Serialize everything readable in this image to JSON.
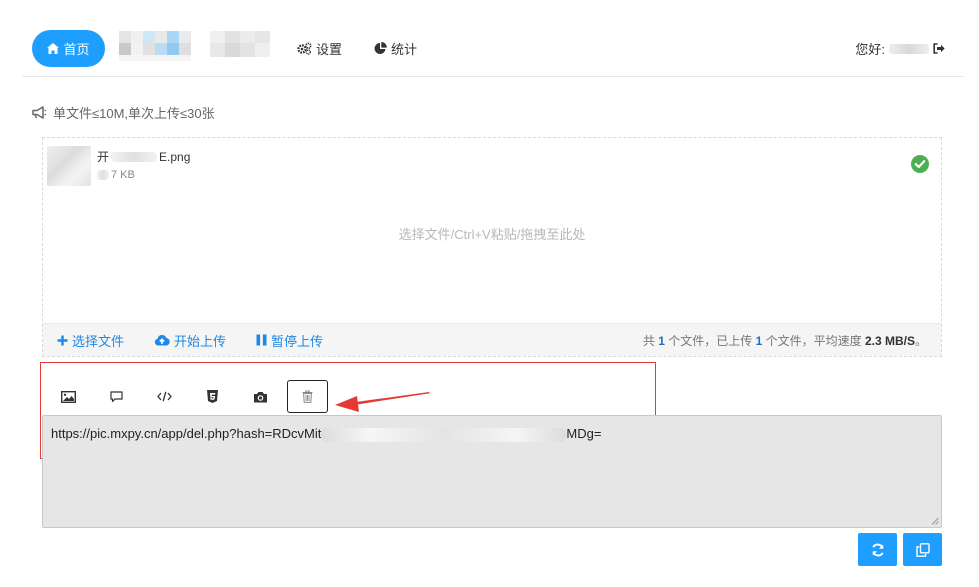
{
  "nav": {
    "home_label": "首页",
    "settings_label": "设置",
    "stats_label": "统计",
    "greeting": "您好:"
  },
  "notice": "单文件≤10M,单次上传≤30张",
  "uploader": {
    "file_name_prefix": "开",
    "file_name_suffix": "E.png",
    "file_size_suffix": "7 KB",
    "drop_hint": "选择文件/Ctrl+V粘贴/拖拽至此处",
    "select_label": "选择文件",
    "start_label": "开始上传",
    "pause_label": "暂停上传",
    "status": {
      "t1": "共 ",
      "total": "1",
      "t2": " 个文件，已上传 ",
      "uploaded": "1",
      "t3": " 个文件，平均速度 ",
      "speed": "2.3 MB/S",
      "t4": "。"
    }
  },
  "output": {
    "url_prefix": "https://pic.mxpy.cn/app/del.php?hash=RDcvMit",
    "url_suffix": "MDg="
  },
  "tools": [
    "image-icon",
    "comment-icon",
    "code-icon",
    "html5-icon",
    "camera-icon",
    "trash-icon"
  ],
  "colors": {
    "accent": "#1e9fff",
    "link": "#1e88e5",
    "success": "#4caf50",
    "highlight": "#e53935"
  }
}
